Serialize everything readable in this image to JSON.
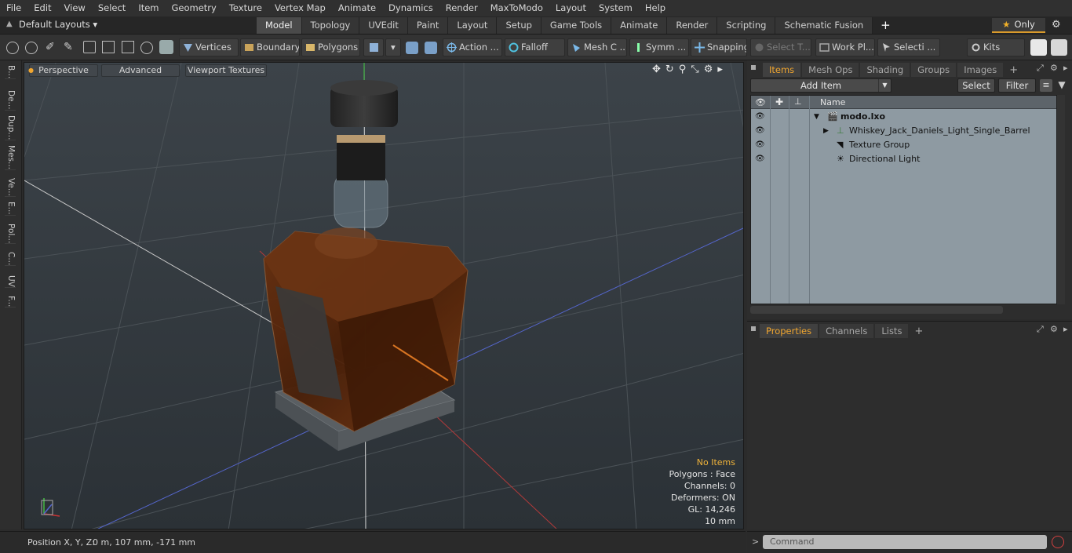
{
  "menu": [
    "File",
    "Edit",
    "View",
    "Select",
    "Item",
    "Geometry",
    "Texture",
    "Vertex Map",
    "Animate",
    "Dynamics",
    "Render",
    "MaxToModo",
    "Layout",
    "System",
    "Help"
  ],
  "layouts": {
    "default_label": "Default Layouts ▾",
    "tabs": [
      "Model",
      "Topology",
      "UVEdit",
      "Paint",
      "Layout",
      "Setup",
      "Game Tools",
      "Animate",
      "Render",
      "Scripting",
      "Schematic Fusion"
    ],
    "active_tab": "Model",
    "add_tab": "+",
    "only_label": "Only"
  },
  "toolbar": {
    "vertices": "Vertices",
    "boundary": "Boundary",
    "polygons": "Polygons",
    "action": "Action  ...",
    "falloff": "Falloff",
    "mesh_c": "Mesh C ...",
    "symm": "Symm ...",
    "snapping": "Snapping",
    "select_t": "Select T...",
    "work_pl": "Work Pl...",
    "selecti": "Selecti ...",
    "kits": "Kits"
  },
  "left_strip": [
    "B...",
    "De...",
    "Dup...",
    "Mes...",
    "Ve...",
    "E...",
    "Pol...",
    "C...",
    "UV",
    "F..."
  ],
  "viewport": {
    "perspective": "Perspective",
    "advanced": "Advanced",
    "viewport_textures": "Viewport Textures",
    "info": {
      "no_items": "No Items",
      "polygons": "Polygons : Face",
      "channels": "Channels: 0",
      "deformers": "Deformers: ON",
      "gl": "GL: 14,246",
      "scale": "10 mm"
    }
  },
  "status": {
    "label": "Position X, Y, Z:",
    "value": "0 m, 107 mm, -171 mm"
  },
  "items_panel": {
    "tabs": [
      "Items",
      "Mesh Ops",
      "Shading",
      "Groups",
      "Images"
    ],
    "active_tab": "Items",
    "add_tab": "+",
    "add_item": "Add Item",
    "select": "Select",
    "filter": "Filter",
    "col_name": "Name",
    "rows": [
      {
        "label": "modo.lxo",
        "bold": true
      },
      {
        "label": "Whiskey_Jack_Daniels_Light_Single_Barrel",
        "bold": false
      },
      {
        "label": "Texture Group",
        "bold": false
      },
      {
        "label": "Directional Light",
        "bold": false
      }
    ]
  },
  "props_panel": {
    "tabs": [
      "Properties",
      "Channels",
      "Lists"
    ],
    "active_tab": "Properties",
    "add_tab": "+"
  },
  "command": {
    "prompt": ">",
    "placeholder": "Command"
  },
  "colors": {
    "accent": "#f0a630",
    "viewport_bg": "#3a4046",
    "list_bg": "#8e9aa2",
    "bottle_amber": "#5a2a0a"
  }
}
